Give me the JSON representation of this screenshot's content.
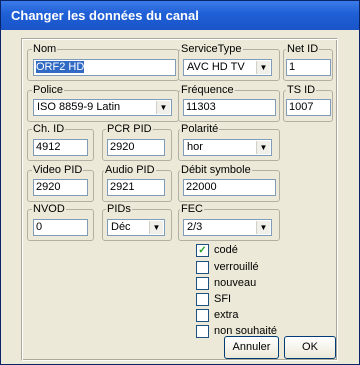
{
  "window": {
    "title": "Changer les données du canal"
  },
  "fields": {
    "nom": {
      "label": "Nom",
      "value": "ORF2 HD"
    },
    "service_type": {
      "label": "ServiceType",
      "value": "AVC HD TV"
    },
    "net_id": {
      "label": "Net ID",
      "value": "1"
    },
    "police": {
      "label": "Police",
      "value": "ISO 8859-9 Latin"
    },
    "frequence": {
      "label": "Fréquence",
      "value": "11303"
    },
    "ts_id": {
      "label": "TS ID",
      "value": "1007"
    },
    "ch_id": {
      "label": "Ch. ID",
      "value": "4912"
    },
    "pcr_pid": {
      "label": "PCR PID",
      "value": "2920"
    },
    "polarite": {
      "label": "Polarité",
      "value": "hor"
    },
    "video_pid": {
      "label": "Video PID",
      "value": "2920"
    },
    "audio_pid": {
      "label": "Audio PID",
      "value": "2921"
    },
    "debit_symbole": {
      "label": "Débit symbole",
      "value": "22000"
    },
    "nvod": {
      "label": "NVOD",
      "value": "0"
    },
    "pids": {
      "label": "PIDs",
      "value": "Déc"
    },
    "fec": {
      "label": "FEC",
      "value": "2/3"
    }
  },
  "checkboxes": [
    {
      "label": "codé",
      "checked": true
    },
    {
      "label": "verrouillé",
      "checked": false
    },
    {
      "label": "nouveau",
      "checked": false
    },
    {
      "label": "SFI",
      "checked": false
    },
    {
      "label": "extra",
      "checked": false
    },
    {
      "label": "non souhaité",
      "checked": false
    }
  ],
  "buttons": {
    "cancel": "Annuler",
    "ok": "OK"
  },
  "icons": {
    "dropdown": "chevron-down-icon",
    "checkmark": "checkmark-icon"
  },
  "colors": {
    "title_bar": "#1f5fd6",
    "selection": "#316ac5",
    "dialog_bg": "#ece9d8"
  }
}
